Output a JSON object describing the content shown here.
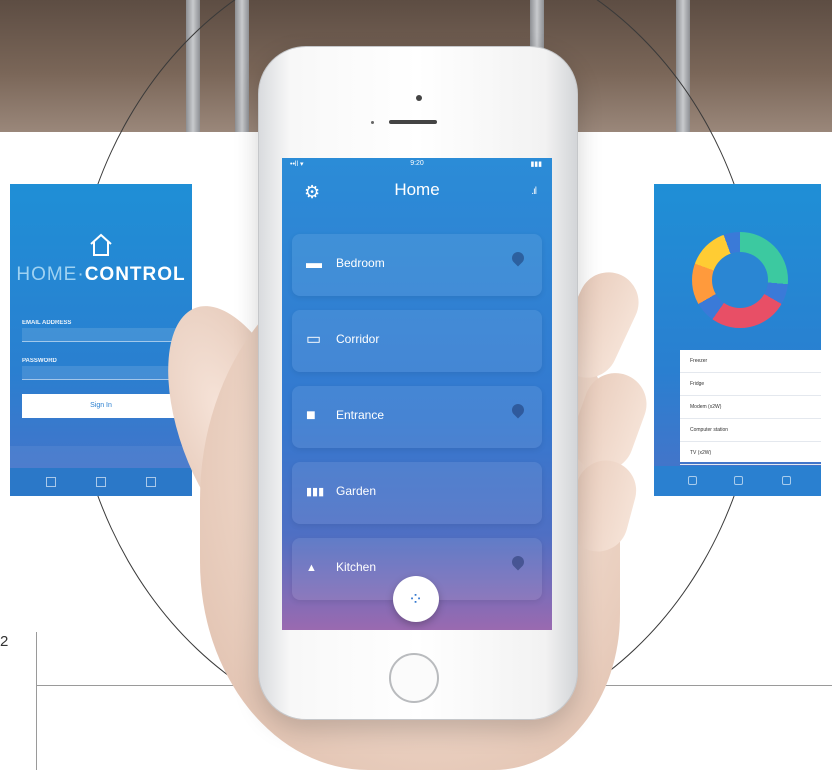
{
  "page": {
    "number": "2"
  },
  "main_app": {
    "status_bar": {
      "signal": "••ll ▾",
      "time": "9:20",
      "battery": "▮▮▮"
    },
    "settings_icon": "gear-icon",
    "title": "Home",
    "stats_icon": "bar-chart-icon",
    "rooms": [
      {
        "label": "Bedroom",
        "icon": "bed-icon",
        "glyph": "▬",
        "has_location_pin": true
      },
      {
        "label": "Corridor",
        "icon": "monitor-icon",
        "glyph": "▭",
        "has_location_pin": false
      },
      {
        "label": "Entrance",
        "icon": "door-icon",
        "glyph": "■",
        "has_location_pin": true
      },
      {
        "label": "Garden",
        "icon": "fence-icon",
        "glyph": "▮▮▮",
        "has_location_pin": false
      },
      {
        "label": "Kitchen",
        "icon": "kitchen-icon",
        "glyph": "▲",
        "has_location_pin": true
      }
    ],
    "fab_icon": "grid-dots-icon",
    "fab_glyph": "⁘",
    "colors": {
      "gradient_top": "#2b8cd7",
      "gradient_bottom": "#9a6ab0",
      "card": "rgba(255,255,255,0.09)"
    }
  },
  "login_screen": {
    "brand_part1": "HOME",
    "brand_separator": "·",
    "brand_part2": "CONTROL",
    "username_label": "EMAIL ADDRESS",
    "password_label": "PASSWORD",
    "sign_in_label": "Sign In"
  },
  "energy_screen": {
    "rows": [
      {
        "label": "Freezer"
      },
      {
        "label": "Fridge"
      },
      {
        "label": "Modem (x2W)"
      },
      {
        "label": "Computer station"
      },
      {
        "label": "TV (x2W)"
      }
    ],
    "donut_colors": [
      "#3cc9a0",
      "#e84f66",
      "#ff9a3c",
      "#ffcc33",
      "#3a7ad8"
    ]
  }
}
